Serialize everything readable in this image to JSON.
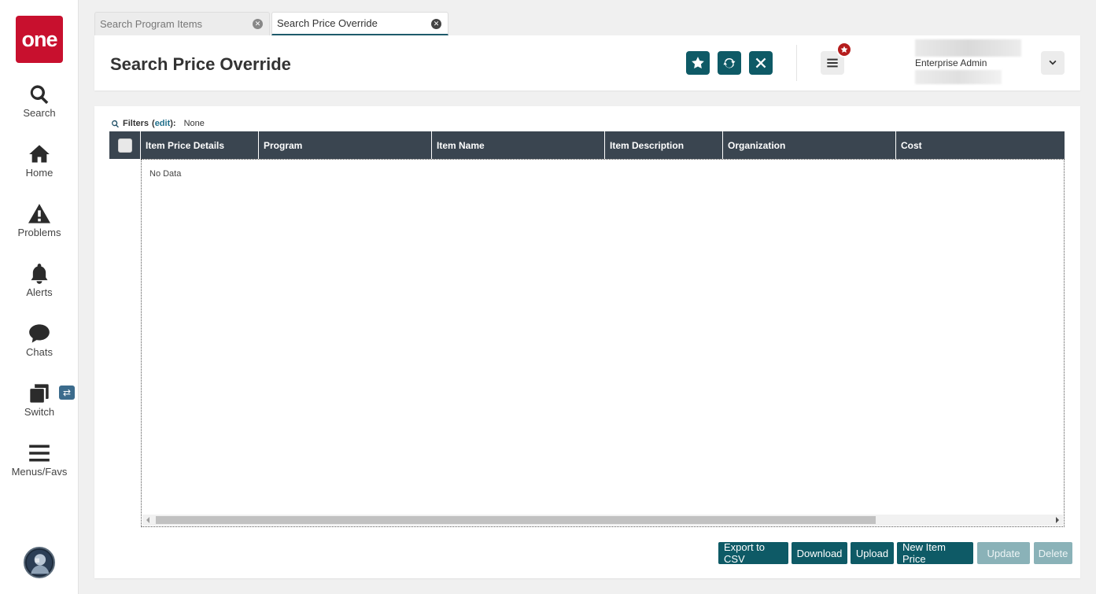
{
  "sidebar": {
    "logo_text": "one",
    "items": [
      {
        "label": "Search",
        "icon": "search-icon"
      },
      {
        "label": "Home",
        "icon": "home-icon"
      },
      {
        "label": "Problems",
        "icon": "warning-icon"
      },
      {
        "label": "Alerts",
        "icon": "bell-icon"
      },
      {
        "label": "Chats",
        "icon": "chat-bubble-icon"
      },
      {
        "label": "Switch",
        "icon": "switch-windows-icon"
      },
      {
        "label": "Menus/Favs",
        "icon": "hamburger-menu-icon"
      }
    ],
    "switch_badge": "⇄"
  },
  "tabs": [
    {
      "label": "Search Program Items",
      "active": false
    },
    {
      "label": "Search Price Override",
      "active": true
    }
  ],
  "header": {
    "title": "Search Price Override",
    "user_role": "Enterprise Admin"
  },
  "filters": {
    "label": "Filters",
    "edit": "edit",
    "value": "None"
  },
  "grid": {
    "columns": [
      "Item Price Details",
      "Program",
      "Item Name",
      "Item Description",
      "Organization",
      "Cost"
    ],
    "empty_text": "No Data",
    "scroll_position": 0.0
  },
  "actions": {
    "export_csv": "Export to CSV",
    "download": "Download",
    "upload": "Upload",
    "new_item_price": "New Item Price",
    "update": "Update",
    "delete": "Delete"
  },
  "colors": {
    "brand_red": "#c8102e",
    "accent_teal": "#0e5a66",
    "grid_header": "#3a4550",
    "disabled_button": "#8ab2b8"
  }
}
